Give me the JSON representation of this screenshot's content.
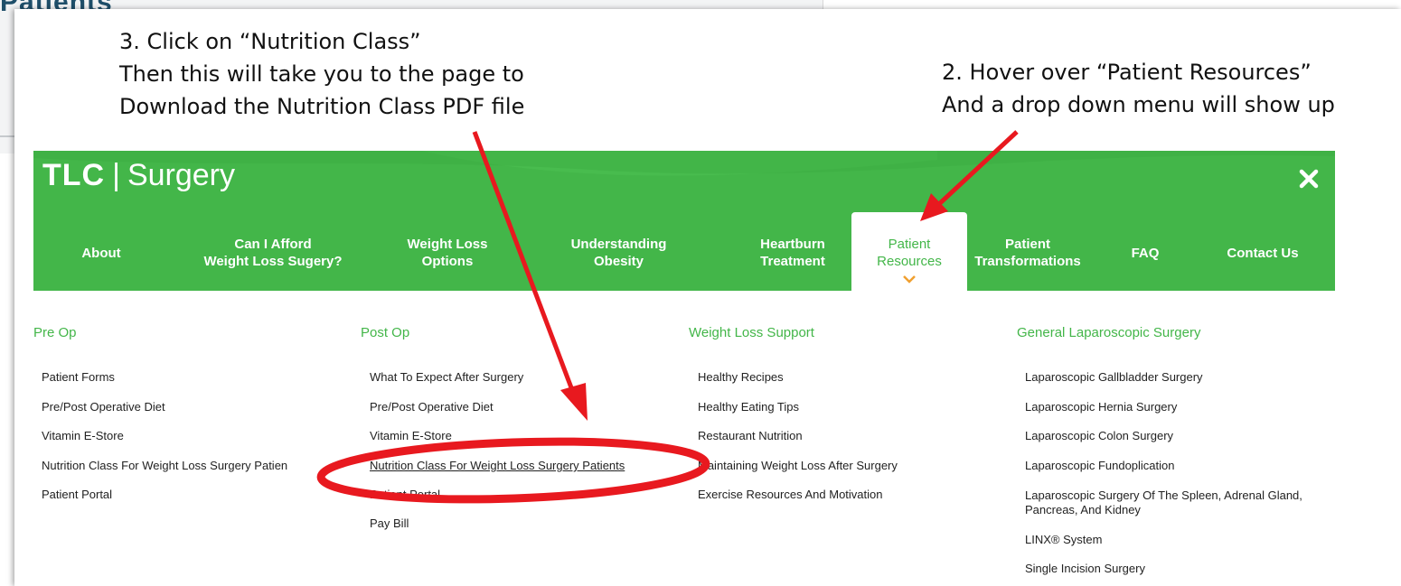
{
  "background_page": {
    "title_fragment": "Patients"
  },
  "annotations": {
    "step3": [
      "3. Click on “Nutrition Class”",
      "Then this will take you to the page to",
      "Download the Nutrition Class PDF file"
    ],
    "step2": [
      "2. Hover over “Patient Resources”",
      "And a drop down menu will show up"
    ]
  },
  "header": {
    "brand": "TLC",
    "pipe": "|",
    "name": "Surgery",
    "close_icon": "close-icon",
    "colors": {
      "green": "#43b649",
      "annotation_red": "#e8191f"
    }
  },
  "nav": {
    "about": "About",
    "afford": [
      "Can I Afford",
      "Weight Loss Sugery?"
    ],
    "options": [
      "Weight Loss",
      "Options"
    ],
    "obesity": [
      "Understanding",
      "Obesity"
    ],
    "heartburn": [
      "Heartburn",
      "Treatment"
    ],
    "resources": [
      "Patient",
      "Resources"
    ],
    "transformations": [
      "Patient",
      "Transformations"
    ],
    "faq": "FAQ",
    "contact": "Contact Us"
  },
  "menu": {
    "pre_op": {
      "heading": "Pre Op",
      "items": [
        "Patient Forms",
        "Pre/Post Operative Diet",
        "Vitamin E-Store",
        "Nutrition Class For Weight Loss Surgery Patien",
        "Patient Portal"
      ]
    },
    "post_op": {
      "heading": "Post Op",
      "items": [
        "What To Expect After Surgery",
        "Pre/Post Operative Diet",
        "Vitamin E-Store",
        "Nutrition Class For Weight Loss Surgery Patients",
        "Patient Portal",
        "Pay Bill"
      ]
    },
    "support": {
      "heading": "Weight Loss Support",
      "items": [
        "Healthy Recipes",
        "Healthy Eating Tips",
        "Restaurant Nutrition",
        "Maintaining Weight Loss After Surgery",
        "Exercise Resources And Motivation"
      ]
    },
    "general": {
      "heading": "General Laparoscopic Surgery",
      "items": [
        "Laparoscopic Gallbladder Surgery",
        "Laparoscopic Hernia Surgery",
        "Laparoscopic Colon Surgery",
        "Laparoscopic Fundoplication",
        "Laparoscopic Surgery Of The Spleen, Adrenal Gland, Pancreas, And Kidney",
        "LINX® System",
        "Single Incision Surgery"
      ]
    }
  }
}
